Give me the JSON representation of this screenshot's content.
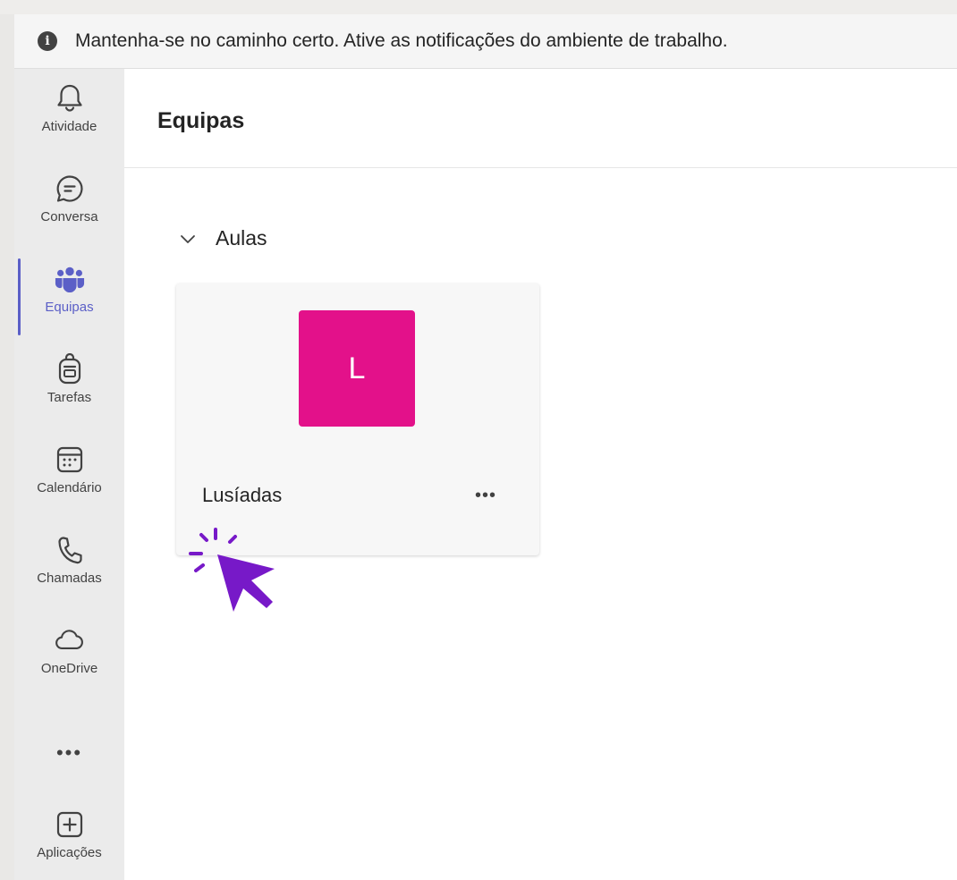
{
  "banner": {
    "icon": "info-icon",
    "message": "Mantenha-se no caminho certo. Ative as notificações do ambiente de trabalho."
  },
  "rail": {
    "items": [
      {
        "label": "Atividade",
        "icon": "bell-icon"
      },
      {
        "label": "Conversa",
        "icon": "chat-icon"
      },
      {
        "label": "Equipas",
        "icon": "teams-icon",
        "active": true
      },
      {
        "label": "Tarefas",
        "icon": "backpack-icon"
      },
      {
        "label": "Calendário",
        "icon": "calendar-icon"
      },
      {
        "label": "Chamadas",
        "icon": "phone-icon"
      },
      {
        "label": "OneDrive",
        "icon": "cloud-icon"
      }
    ],
    "more": "•••",
    "apps_label": "Aplicações",
    "accent": "#5b5fc7"
  },
  "header": {
    "title": "Equipas"
  },
  "group": {
    "name": "Aulas"
  },
  "team": {
    "initial": "L",
    "name": "Lusíadas",
    "color": "#e3118a",
    "more": "•••"
  },
  "cursor_color": "#7719c8"
}
